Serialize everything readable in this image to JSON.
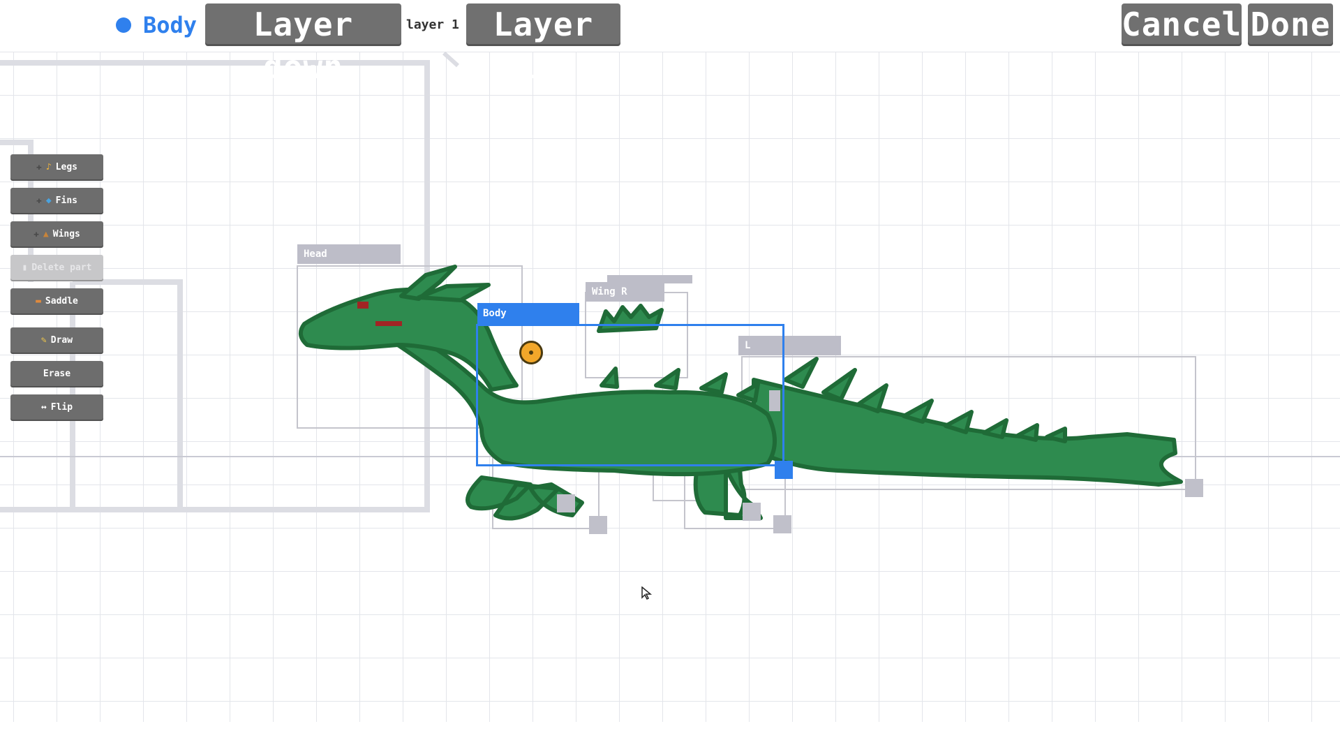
{
  "toolbar": {
    "part_name": "Body",
    "layer_down_label": "Layer down",
    "layer_label": "layer 1",
    "layer_up_label": "Layer up",
    "cancel_label": "Cancel",
    "done_label": "Done",
    "part_color": "#2f80ed"
  },
  "sidebar": {
    "legs_label": "Legs",
    "legs_icon": "leg-icon",
    "fins_label": "Fins",
    "fins_icon": "fish-icon",
    "wings_label": "Wings",
    "wings_icon": "bird-icon",
    "delete_label": "Delete part",
    "delete_icon": "trash-icon",
    "saddle_label": "Saddle",
    "saddle_icon": "saddle-icon",
    "draw_label": "Draw",
    "draw_icon": "pencil-icon",
    "erase_label": "Erase",
    "flip_label": "Flip",
    "flip_icon": "flip-arrows-icon"
  },
  "parts": {
    "head_label": "Head",
    "wing_label": "Wing R",
    "body_label": "Body",
    "tail_label": "L"
  },
  "colors": {
    "selection": "#2f80ed",
    "dragon_green": "#2e8b4f",
    "dragon_outline": "#1f6b37",
    "pivot": "#f2a72a",
    "button_gray": "#707070"
  }
}
